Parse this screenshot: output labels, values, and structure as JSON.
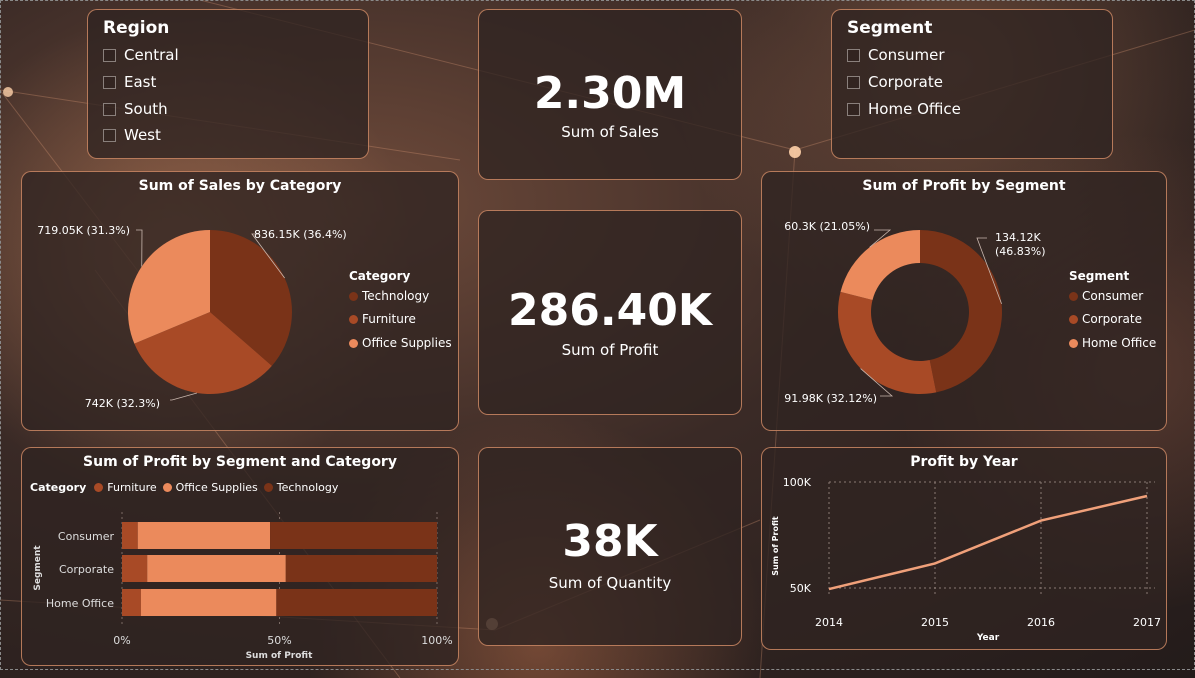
{
  "colors": {
    "technology": "#7a3318",
    "furniture": "#a84a26",
    "office_supplies": "#eb8a5c",
    "accent": "#e2966e"
  },
  "region_slicer": {
    "title": "Region",
    "items": [
      "Central",
      "East",
      "South",
      "West"
    ]
  },
  "segment_slicer": {
    "title": "Segment",
    "items": [
      "Consumer",
      "Corporate",
      "Home Office"
    ]
  },
  "kpis": {
    "sales": {
      "value": "2.30M",
      "label": "Sum of Sales"
    },
    "profit": {
      "value": "286.40K",
      "label": "Sum of Profit"
    },
    "quantity": {
      "value": "38K",
      "label": "Sum of Quantity"
    }
  },
  "chart_data": [
    {
      "type": "pie",
      "title": "Sum of Sales by Category",
      "legend_title": "Category",
      "legend_position": "right",
      "slices": [
        {
          "name": "Technology",
          "value": 836.15,
          "label": "836.15K (36.4%)",
          "color": "#7a3318"
        },
        {
          "name": "Furniture",
          "value": 742.0,
          "label": "742K (32.3%)",
          "color": "#a84a26"
        },
        {
          "name": "Office Supplies",
          "value": 719.05,
          "label": "719.05K (31.3%)",
          "color": "#eb8a5c"
        }
      ]
    },
    {
      "type": "pie",
      "title": "Sum of Profit by Segment",
      "legend_title": "Segment",
      "legend_position": "right",
      "slices": [
        {
          "name": "Consumer",
          "value": 134.12,
          "label": "134.12K (46.83%)",
          "color": "#7a3318"
        },
        {
          "name": "Corporate",
          "value": 91.98,
          "label": "91.98K (32.12%)",
          "color": "#a84a26"
        },
        {
          "name": "Home Office",
          "value": 60.3,
          "label": "60.3K (21.05%)",
          "color": "#eb8a5c"
        }
      ]
    },
    {
      "type": "bar",
      "orientation": "horizontal",
      "stacked": "100%",
      "title": "Sum of Profit by Segment and Category",
      "legend_title": "Category",
      "legend_position": "top-left",
      "xlabel": "Sum of Profit",
      "ylabel": "Segment",
      "categories": [
        "Consumer",
        "Corporate",
        "Home Office"
      ],
      "x_ticks": [
        "0%",
        "50%",
        "100%"
      ],
      "series": [
        {
          "name": "Furniture",
          "color": "#a84a26",
          "values": [
            5,
            8,
            6
          ]
        },
        {
          "name": "Office Supplies",
          "color": "#eb8a5c",
          "values": [
            42,
            44,
            43
          ]
        },
        {
          "name": "Technology",
          "color": "#7a3318",
          "values": [
            53,
            48,
            51
          ]
        }
      ]
    },
    {
      "type": "line",
      "title": "Profit by Year",
      "xlabel": "Year",
      "ylabel": "Sum of Profit",
      "x": [
        "2014",
        "2015",
        "2016",
        "2017"
      ],
      "y": [
        49.5,
        61.6,
        81.8,
        93.4
      ],
      "y_ticks": [
        {
          "v": 50,
          "label": "50K"
        },
        {
          "v": 100,
          "label": "100K"
        }
      ],
      "ylim": [
        50,
        100
      ],
      "grid": true,
      "color": "#f0a07a"
    }
  ]
}
